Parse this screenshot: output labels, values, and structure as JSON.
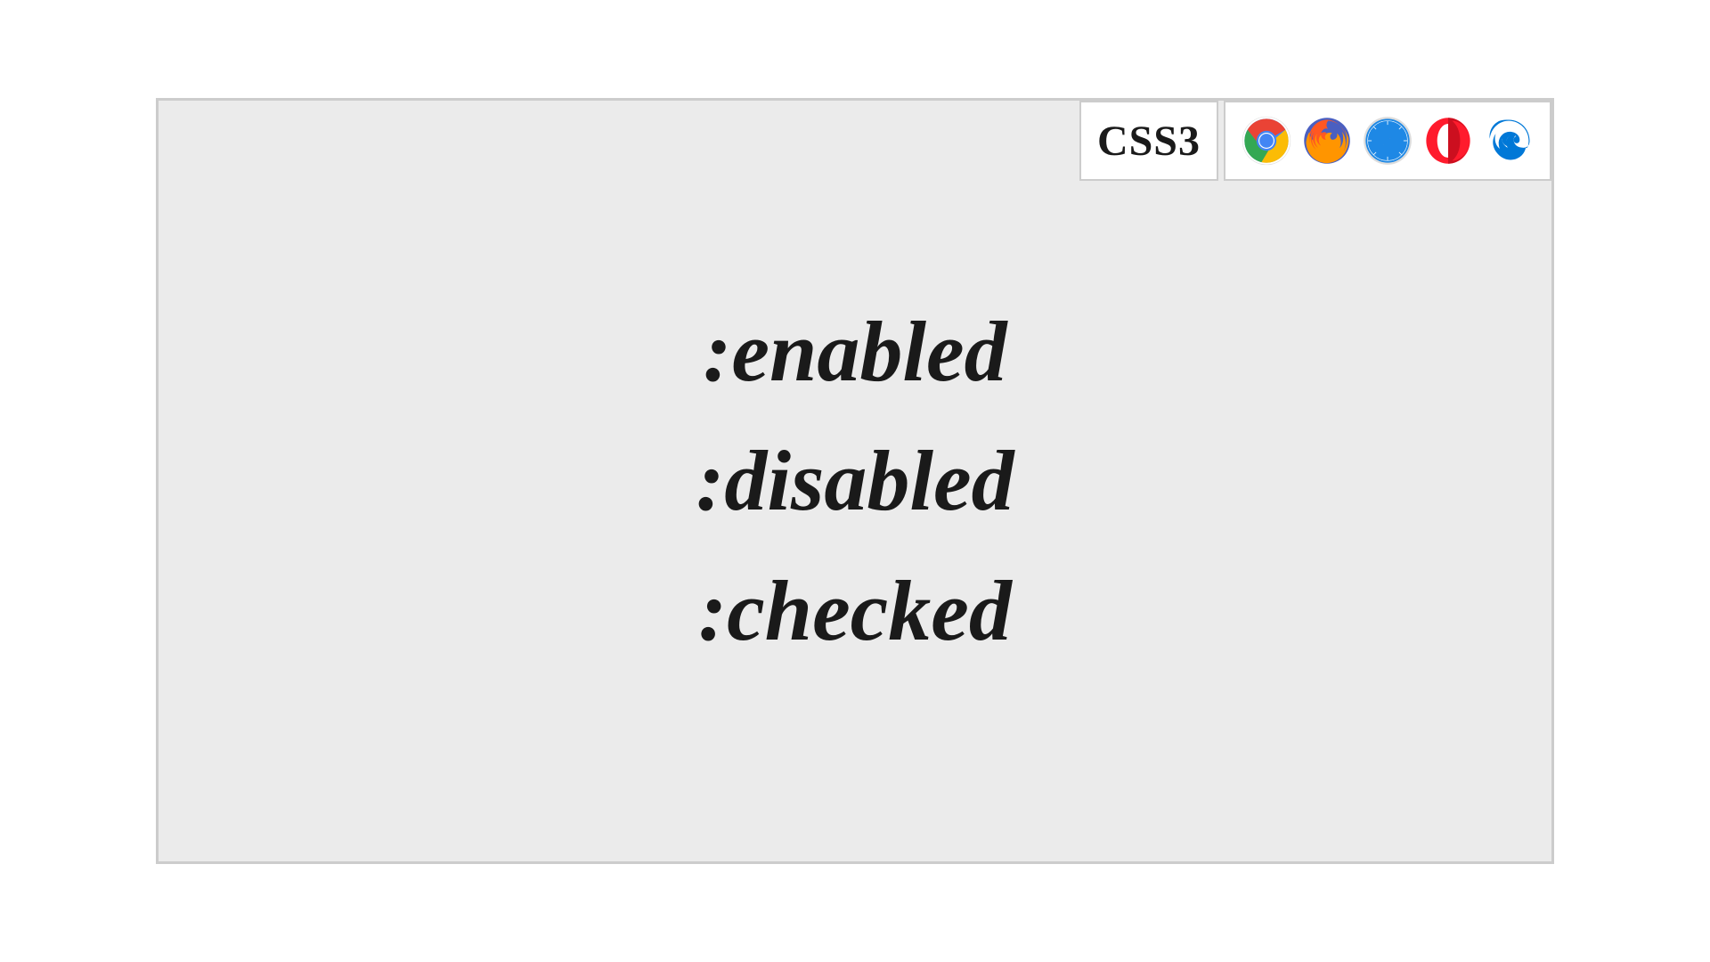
{
  "badge": {
    "css_label": "CSS3"
  },
  "browsers": [
    "chrome",
    "firefox",
    "safari",
    "opera",
    "edge"
  ],
  "selectors": {
    "line1": ":enabled",
    "line2": ":disabled",
    "line3": ":checked"
  }
}
